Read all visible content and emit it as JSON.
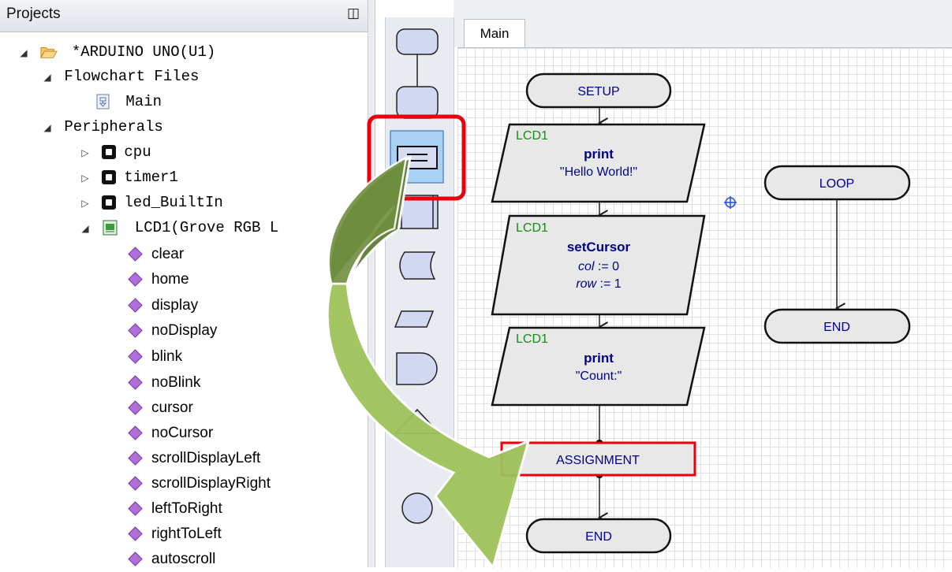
{
  "projects": {
    "title": "Projects",
    "root": "*ARDUINO UNO(U1)",
    "flowchart_files": "Flowchart Files",
    "main_file": "Main",
    "peripherals": "Peripherals",
    "devices": [
      "cpu",
      "timer1",
      "led_BuiltIn",
      "LCD1(Grove RGB L"
    ],
    "methods": [
      "clear",
      "home",
      "display",
      "noDisplay",
      "blink",
      "noBlink",
      "cursor",
      "noCursor",
      "scrollDisplayLeft",
      "scrollDisplayRight",
      "leftToRight",
      "rightToLeft",
      "autoscroll"
    ]
  },
  "editor": {
    "tab": "Main",
    "setup": "SETUP",
    "lcd_label": "LCD1",
    "block1": {
      "method": "print",
      "arg": "\"Hello World!\""
    },
    "block2": {
      "method": "setCursor",
      "arg1_name": "col",
      "arg1_val": " := 0",
      "arg2_name": "row",
      "arg2_val": " := 1"
    },
    "block3": {
      "method": "print",
      "arg": "\"Count:\""
    },
    "assignment": "ASSIGNMENT",
    "end": "END",
    "loop": "LOOP",
    "loop_end": "END"
  },
  "colors": {
    "highlight": "#e8000c",
    "block_fill": "#e8e8e8",
    "method_text": "#00008b",
    "label_green": "#1a8a1a",
    "arrow_dark": "#5f7d36",
    "arrow_light": "#9fc25a"
  }
}
